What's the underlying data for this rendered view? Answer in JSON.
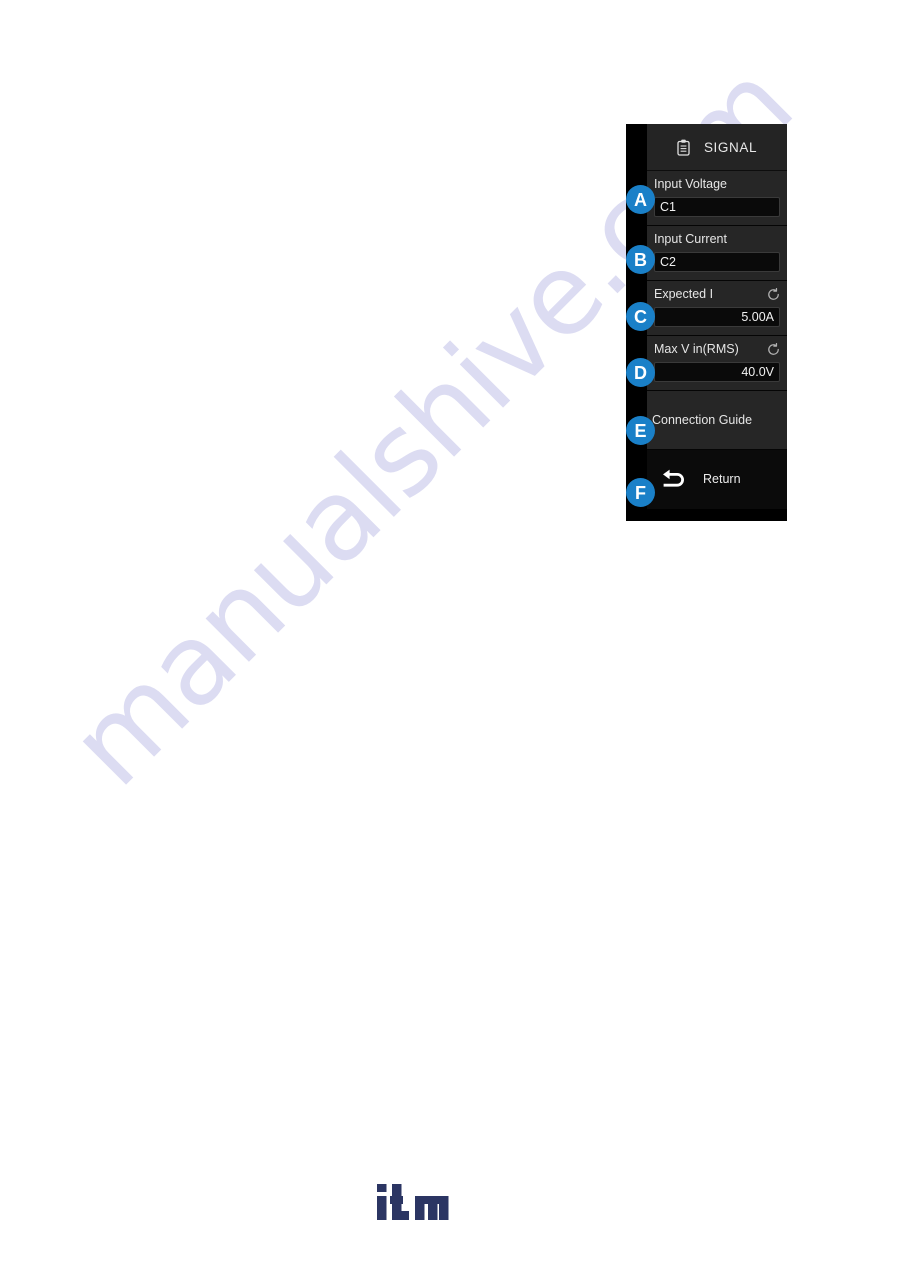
{
  "page": {
    "watermark_text": "manualshive.com",
    "logo_text": "itm",
    "logo_color": "#2b3563",
    "background_color": "#ffffff"
  },
  "scope_menu": {
    "accent_color": "#1a80c8",
    "panel_background": "#000000",
    "row_background": "#262626",
    "header": {
      "title": "SIGNAL",
      "icon": "clipboard-icon"
    },
    "rows": [
      {
        "badge": "A",
        "label": "Input Voltage",
        "value": "C1",
        "value_align": "left",
        "has_refresh": false
      },
      {
        "badge": "B",
        "label": "Input Current",
        "value": "C2",
        "value_align": "left",
        "has_refresh": false
      },
      {
        "badge": "C",
        "label": "Expected I",
        "value": "5.00A",
        "value_align": "right",
        "has_refresh": true,
        "refresh_icon": "refresh-icon"
      },
      {
        "badge": "D",
        "label": "Max V in(RMS)",
        "value": "40.0V",
        "value_align": "right",
        "has_refresh": true,
        "refresh_icon": "refresh-icon"
      }
    ],
    "guide": {
      "badge": "E",
      "label": "Connection Guide"
    },
    "return": {
      "badge": "F",
      "label": "Return",
      "icon": "return-arrow-icon"
    }
  }
}
